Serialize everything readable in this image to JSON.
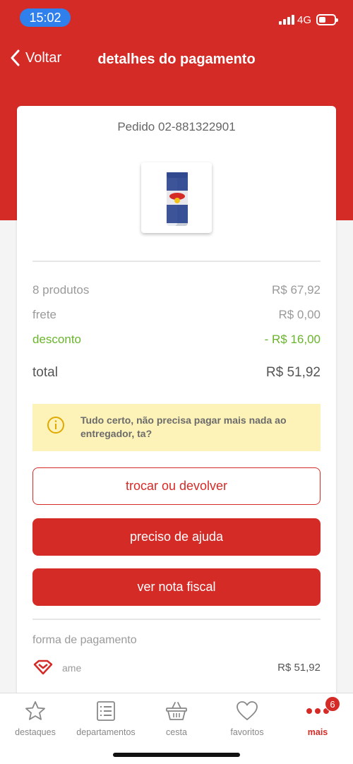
{
  "status_bar": {
    "time": "15:02",
    "network": "4G"
  },
  "header": {
    "back_label": "Voltar",
    "title": "detalhes do pagamento"
  },
  "order": {
    "label": "Pedido 02-881322901"
  },
  "summary": {
    "products_label": "8 produtos",
    "products_value": "R$ 67,92",
    "shipping_label": "frete",
    "shipping_value": "R$ 0,00",
    "discount_label": "desconto",
    "discount_value": "- R$ 16,00",
    "total_label": "total",
    "total_value": "R$ 51,92"
  },
  "notice": {
    "text": "Tudo certo, não precisa pagar mais nada ao entregador, ta?"
  },
  "actions": {
    "exchange_label": "trocar ou devolver",
    "help_label": "preciso de ajuda",
    "invoice_label": "ver nota fiscal"
  },
  "payment": {
    "title": "forma de pagamento",
    "method": "ame",
    "amount": "R$ 51,92"
  },
  "bottom_nav": {
    "items": [
      {
        "label": "destaques",
        "icon": "star-icon"
      },
      {
        "label": "departamentos",
        "icon": "list-icon"
      },
      {
        "label": "cesta",
        "icon": "basket-icon"
      },
      {
        "label": "favoritos",
        "icon": "heart-icon"
      },
      {
        "label": "mais",
        "icon": "more-icon"
      }
    ],
    "badge": "6"
  },
  "colors": {
    "brand_red": "#d52b27",
    "discount_green": "#6ab42d",
    "notice_bg": "#fdf3b8",
    "status_pill": "#2f80ed"
  }
}
